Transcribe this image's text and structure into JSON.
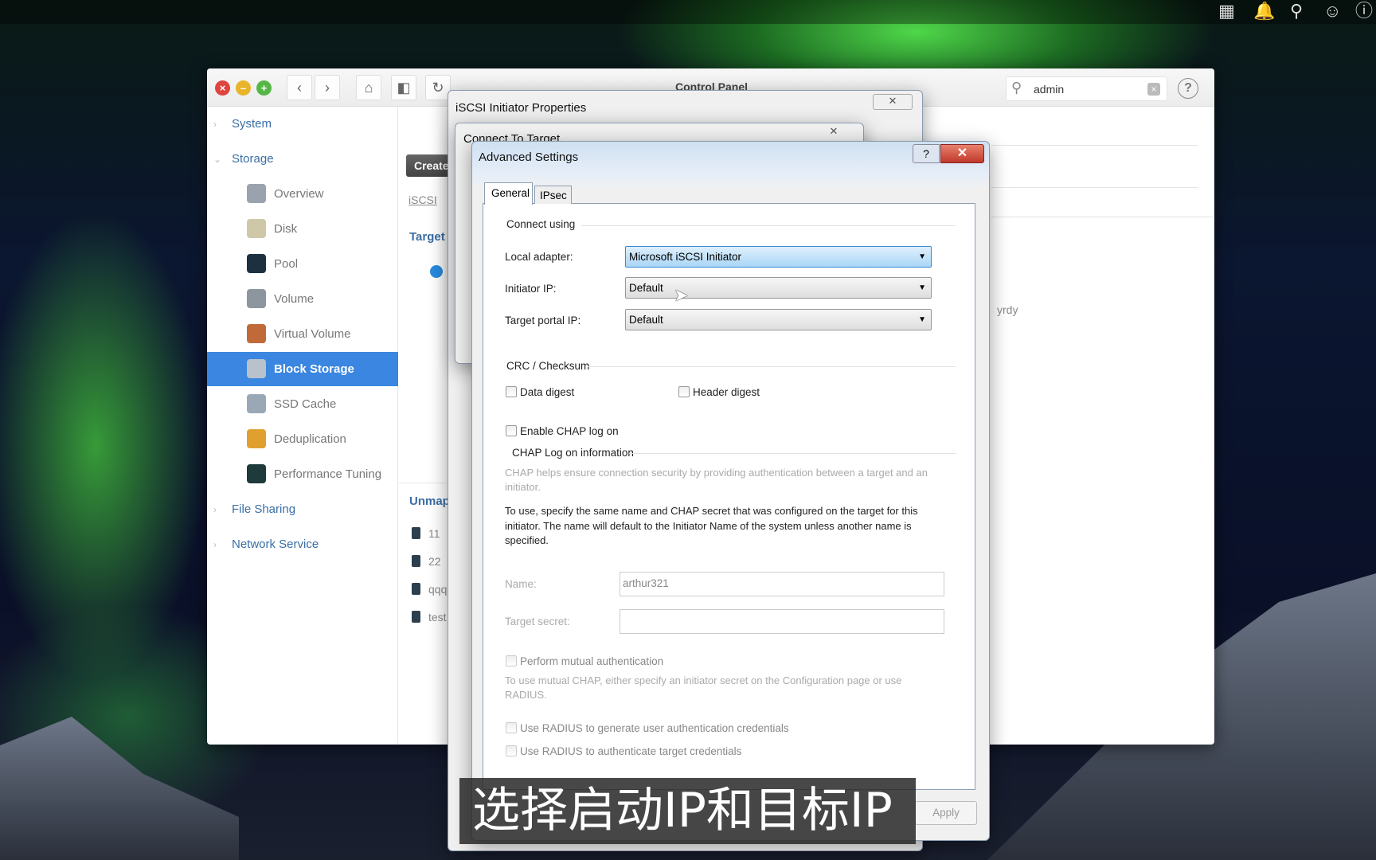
{
  "topbar": {
    "icons": [
      "grid-icon",
      "bell-icon",
      "search-icon",
      "user-icon",
      "help-icon"
    ]
  },
  "control_panel": {
    "title": "Control Panel",
    "search": {
      "value": "admin"
    },
    "sidebar": {
      "system": "System",
      "storage": "Storage",
      "items": [
        {
          "label": "Overview",
          "icon": "overview-icon"
        },
        {
          "label": "Disk",
          "icon": "disk-icon"
        },
        {
          "label": "Pool",
          "icon": "pool-icon"
        },
        {
          "label": "Volume",
          "icon": "volume-icon"
        },
        {
          "label": "Virtual Volume",
          "icon": "virtual-volume-icon"
        },
        {
          "label": "Block Storage",
          "icon": "block-storage-icon",
          "selected": true
        },
        {
          "label": "SSD Cache",
          "icon": "ssd-cache-icon"
        },
        {
          "label": "Deduplication",
          "icon": "deduplication-icon"
        },
        {
          "label": "Performance Tuning",
          "icon": "performance-icon"
        }
      ],
      "file_sharing": "File Sharing",
      "network_service": "Network Service"
    },
    "content": {
      "create": "Create",
      "tab": "iSCSI",
      "target": "Target",
      "unmapped": "Unmap",
      "luns": [
        "11",
        "22",
        "qqq",
        "test"
      ],
      "right_text": "yrdy"
    }
  },
  "initiator_window": {
    "title": "iSCSI Initiator Properties"
  },
  "connect_window": {
    "title": "Connect To Target"
  },
  "advanced": {
    "title": "Advanced Settings",
    "tabs": [
      "General",
      "IPsec"
    ],
    "connect_using": "Connect using",
    "local_adapter_label": "Local adapter:",
    "local_adapter": "Microsoft iSCSI Initiator",
    "initiator_ip_label": "Initiator IP:",
    "initiator_ip": "Default",
    "target_portal_label": "Target portal IP:",
    "target_portal": "Default",
    "crc": "CRC / Checksum",
    "data_digest": "Data digest",
    "header_digest": "Header digest",
    "enable_chap": "Enable CHAP log on",
    "chap_info": "CHAP Log on information",
    "chap_help": "CHAP helps ensure connection security by providing authentication between a target and an initiator.",
    "chap_use": "To use, specify the same name and CHAP secret that was configured on the target for this initiator.  The name will default to the Initiator Name of the system unless another name is specified.",
    "name_label": "Name:",
    "name_value": "arthur321",
    "secret_label": "Target secret:",
    "secret_value": "",
    "mutual": "Perform mutual authentication",
    "mutual_help": "To use mutual CHAP, either specify an initiator secret on the Configuration page or use RADIUS.",
    "radius_gen": "Use RADIUS to generate user authentication credentials",
    "radius_auth": "Use RADIUS to authenticate target credentials",
    "apply": "Apply"
  },
  "subtitle": "选择启动IP和目标IP"
}
